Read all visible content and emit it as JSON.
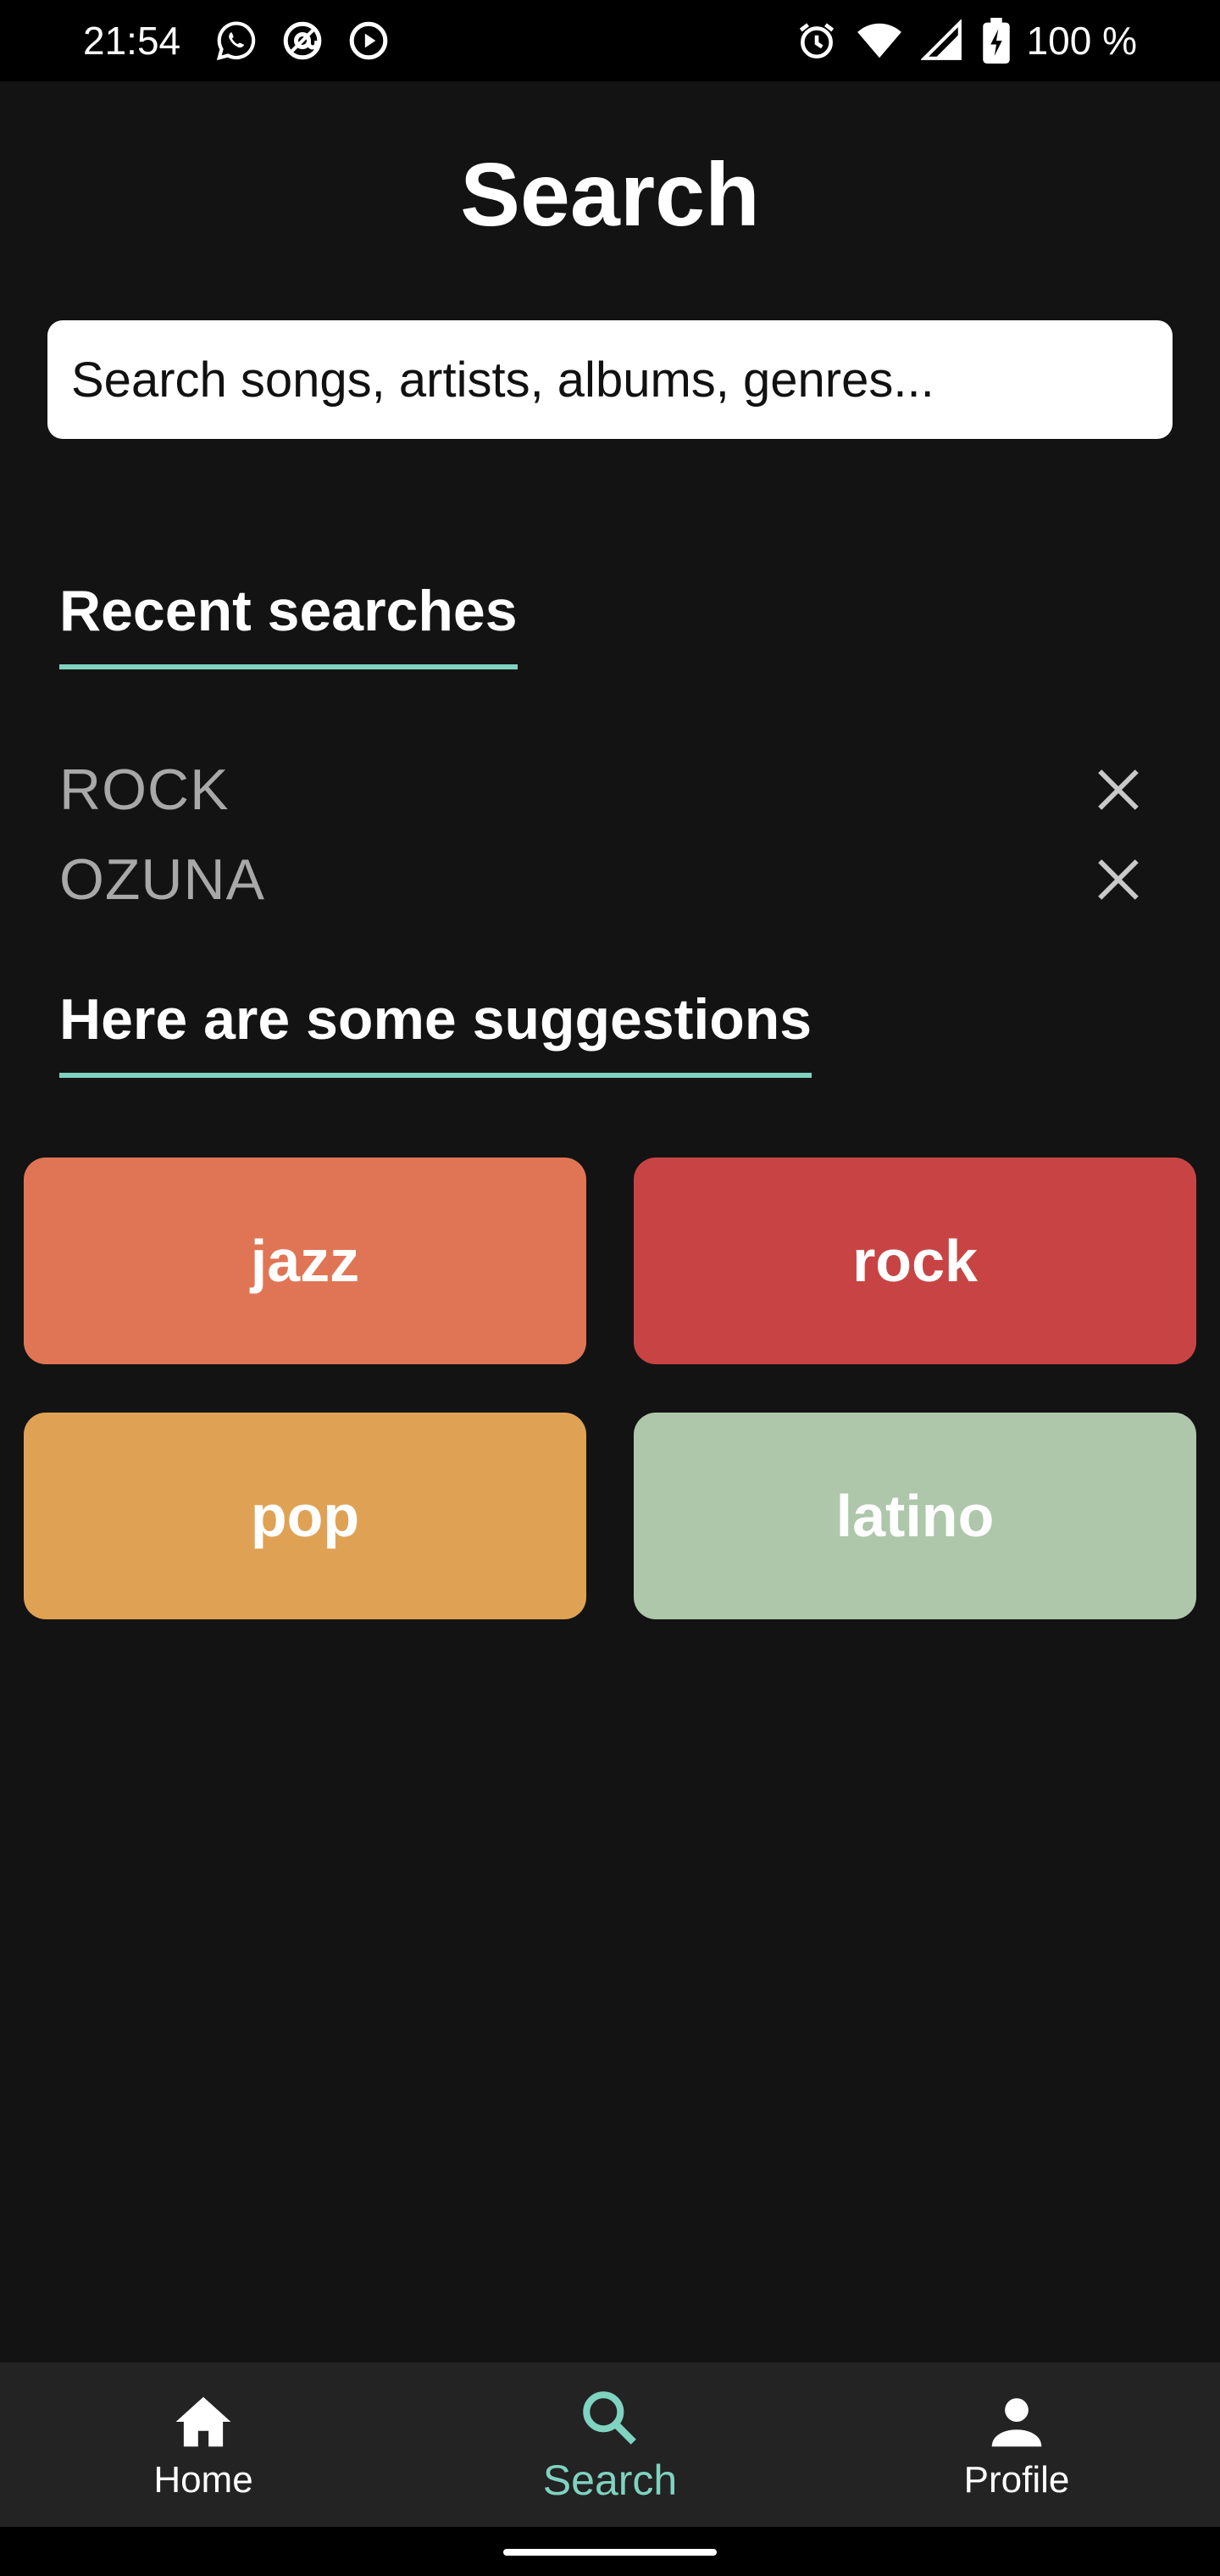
{
  "status_bar": {
    "time": "21:54",
    "battery": "100 %",
    "left_icons": [
      "whatsapp-icon",
      "at-sign-icon",
      "play-circle-icon"
    ],
    "right_icons": [
      "alarm-icon",
      "wifi-icon",
      "cell-signal-icon",
      "battery-charging-icon"
    ]
  },
  "page": {
    "title": "Search"
  },
  "search": {
    "placeholder": "Search songs, artists, albums, genres...",
    "value": ""
  },
  "recent": {
    "heading": "Recent searches",
    "items": [
      {
        "label": "ROCK"
      },
      {
        "label": "OZUNA"
      }
    ],
    "remove_icon": "close-icon"
  },
  "suggestions": {
    "heading": "Here are some suggestions",
    "genres": [
      {
        "label": "jazz",
        "color": "#e07555"
      },
      {
        "label": "rock",
        "color": "#c84444"
      },
      {
        "label": "pop",
        "color": "#dfa255"
      },
      {
        "label": "latino",
        "color": "#aec7aa"
      }
    ]
  },
  "bottom_nav": {
    "items": [
      {
        "label": "Home",
        "icon": "home-icon"
      },
      {
        "label": "Search",
        "icon": "search-icon",
        "active": true
      },
      {
        "label": "Profile",
        "icon": "person-icon"
      }
    ]
  },
  "colors": {
    "accent": "#7fd3c0",
    "background": "#131313",
    "nav_background": "#232323"
  }
}
